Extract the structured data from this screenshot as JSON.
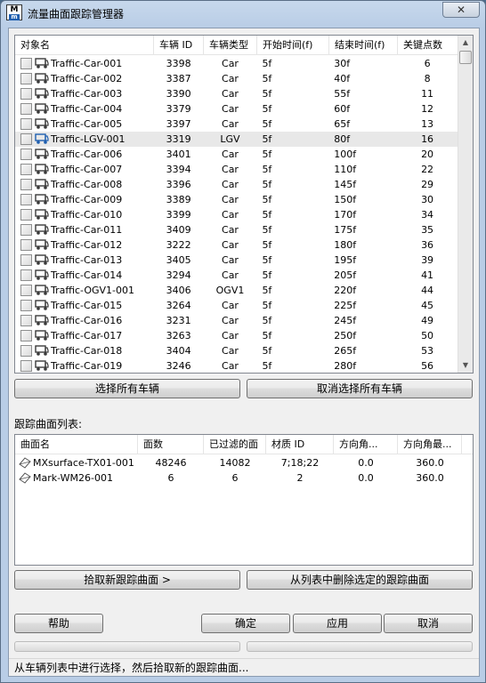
{
  "window": {
    "title": "流量曲面跟踪管理器",
    "icon_text": "M",
    "icon_sub": "m",
    "close_glyph": "✕"
  },
  "vehicles": {
    "columns": [
      "对象名",
      "车辆 ID",
      "车辆类型",
      "开始时间(f)",
      "结束时间(f)",
      "关键点数"
    ],
    "rows": [
      {
        "name": "Traffic-Car-001",
        "id": "3398",
        "type": "Car",
        "start": "5f",
        "end": "30f",
        "keys": "6",
        "icon": "car-icon"
      },
      {
        "name": "Traffic-Car-002",
        "id": "3387",
        "type": "Car",
        "start": "5f",
        "end": "40f",
        "keys": "8",
        "icon": "car-icon"
      },
      {
        "name": "Traffic-Car-003",
        "id": "3390",
        "type": "Car",
        "start": "5f",
        "end": "55f",
        "keys": "11",
        "icon": "car-icon"
      },
      {
        "name": "Traffic-Car-004",
        "id": "3379",
        "type": "Car",
        "start": "5f",
        "end": "60f",
        "keys": "12",
        "icon": "car-icon"
      },
      {
        "name": "Traffic-Car-005",
        "id": "3397",
        "type": "Car",
        "start": "5f",
        "end": "65f",
        "keys": "13",
        "icon": "car-icon"
      },
      {
        "name": "Traffic-LGV-001",
        "id": "3319",
        "type": "LGV",
        "start": "5f",
        "end": "80f",
        "keys": "16",
        "icon": "lgv-icon",
        "selected": true
      },
      {
        "name": "Traffic-Car-006",
        "id": "3401",
        "type": "Car",
        "start": "5f",
        "end": "100f",
        "keys": "20",
        "icon": "car-icon"
      },
      {
        "name": "Traffic-Car-007",
        "id": "3394",
        "type": "Car",
        "start": "5f",
        "end": "110f",
        "keys": "22",
        "icon": "car-icon"
      },
      {
        "name": "Traffic-Car-008",
        "id": "3396",
        "type": "Car",
        "start": "5f",
        "end": "145f",
        "keys": "29",
        "icon": "car-icon"
      },
      {
        "name": "Traffic-Car-009",
        "id": "3389",
        "type": "Car",
        "start": "5f",
        "end": "150f",
        "keys": "30",
        "icon": "car-icon"
      },
      {
        "name": "Traffic-Car-010",
        "id": "3399",
        "type": "Car",
        "start": "5f",
        "end": "170f",
        "keys": "34",
        "icon": "car-icon"
      },
      {
        "name": "Traffic-Car-011",
        "id": "3409",
        "type": "Car",
        "start": "5f",
        "end": "175f",
        "keys": "35",
        "icon": "car-icon"
      },
      {
        "name": "Traffic-Car-012",
        "id": "3222",
        "type": "Car",
        "start": "5f",
        "end": "180f",
        "keys": "36",
        "icon": "car-icon"
      },
      {
        "name": "Traffic-Car-013",
        "id": "3405",
        "type": "Car",
        "start": "5f",
        "end": "195f",
        "keys": "39",
        "icon": "car-icon"
      },
      {
        "name": "Traffic-Car-014",
        "id": "3294",
        "type": "Car",
        "start": "5f",
        "end": "205f",
        "keys": "41",
        "icon": "car-icon"
      },
      {
        "name": "Traffic-OGV1-001",
        "id": "3406",
        "type": "OGV1",
        "start": "5f",
        "end": "220f",
        "keys": "44",
        "icon": "ogv-icon"
      },
      {
        "name": "Traffic-Car-015",
        "id": "3264",
        "type": "Car",
        "start": "5f",
        "end": "225f",
        "keys": "45",
        "icon": "car-icon"
      },
      {
        "name": "Traffic-Car-016",
        "id": "3231",
        "type": "Car",
        "start": "5f",
        "end": "245f",
        "keys": "49",
        "icon": "car-icon"
      },
      {
        "name": "Traffic-Car-017",
        "id": "3263",
        "type": "Car",
        "start": "5f",
        "end": "250f",
        "keys": "50",
        "icon": "car-icon"
      },
      {
        "name": "Traffic-Car-018",
        "id": "3404",
        "type": "Car",
        "start": "5f",
        "end": "265f",
        "keys": "53",
        "icon": "car-icon"
      },
      {
        "name": "Traffic-Car-019",
        "id": "3246",
        "type": "Car",
        "start": "5f",
        "end": "280f",
        "keys": "56",
        "icon": "car-icon"
      }
    ]
  },
  "buttons": {
    "select_all": "选择所有车辆",
    "deselect_all": "取消选择所有车辆",
    "pick_surface": "拾取新跟踪曲面 >",
    "remove_surface": "从列表中删除选定的跟踪曲面",
    "help": "帮助",
    "ok": "确定",
    "apply": "应用",
    "cancel": "取消"
  },
  "surfaces": {
    "label": "跟踪曲面列表:",
    "columns": [
      "曲面名",
      "面数",
      "已过滤的面",
      "材质 ID",
      "方向角...",
      "方向角最..."
    ],
    "rows": [
      {
        "name": "MXsurface-TX01-001",
        "faces": "48246",
        "filtered": "14082",
        "mat": "7;18;22",
        "dir_min": "0.0",
        "dir_max": "360.0"
      },
      {
        "name": "Mark-WM26-001",
        "faces": "6",
        "filtered": "6",
        "mat": "2",
        "dir_min": "0.0",
        "dir_max": "360.0"
      }
    ]
  },
  "status": {
    "text": "从车辆列表中进行选择，然后拾取新的跟踪曲面..."
  },
  "colors": {
    "car_icon": "#3a3a3a",
    "lgv_icon": "#1f5fb0"
  }
}
